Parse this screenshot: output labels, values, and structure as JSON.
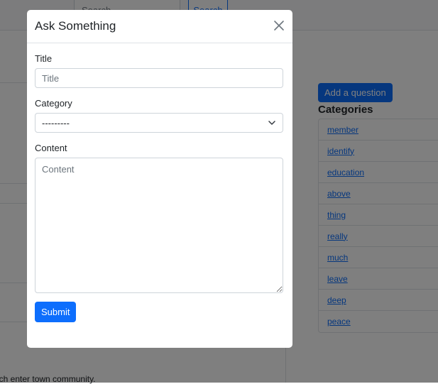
{
  "background": {
    "search": {
      "placeholder": "Search",
      "button_label": "Search"
    },
    "sidebar": {
      "ask_button_label": "Add a question",
      "categories_title": "Categories",
      "categories": [
        "member",
        "identify",
        "education",
        "above",
        "thing",
        "really",
        "much",
        "leave",
        "deep",
        "peace"
      ]
    },
    "footer_text": "uch enter town community."
  },
  "modal": {
    "title": "Ask Something",
    "close_icon": "close-icon",
    "fields": {
      "title": {
        "label": "Title",
        "placeholder": "Title"
      },
      "category": {
        "label": "Category",
        "selected": "---------"
      },
      "content": {
        "label": "Content",
        "placeholder": "Content"
      }
    },
    "submit_label": "Submit"
  },
  "colors": {
    "primary": "#0d6efd",
    "backdrop": "#000000"
  }
}
